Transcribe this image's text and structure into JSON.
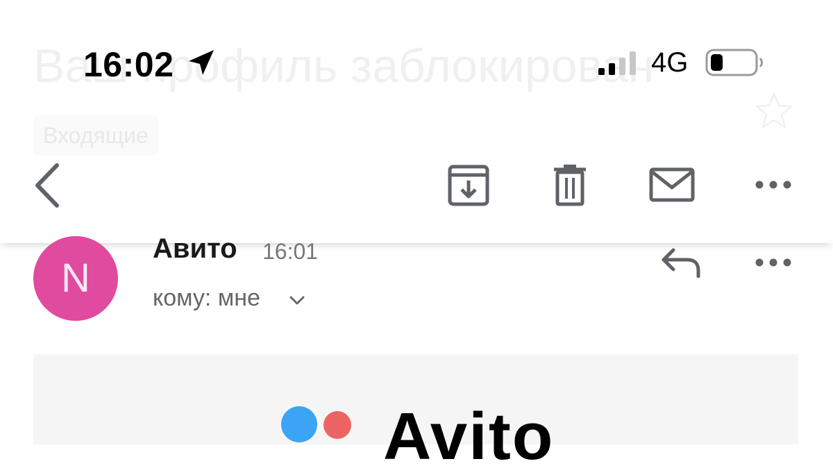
{
  "status_bar": {
    "time": "16:02",
    "network": "4G",
    "icons": [
      "location-arrow-icon",
      "signal-icon",
      "battery-icon"
    ]
  },
  "email": {
    "subject": "Ваш профиль заблокирован",
    "folder": "Входящие",
    "sender": "Авито",
    "sender_initial": "N",
    "sent_time": "16:01",
    "recipient": "кому: мне",
    "brand_logo_text": "Avito"
  },
  "toolbar": {
    "icons": [
      "back-icon",
      "archive-icon",
      "trash-icon",
      "mail-icon",
      "more-icon"
    ]
  },
  "colors": {
    "avatar_bg": "#e04a9f",
    "logo_blue": "#3ba4f5",
    "logo_red": "#ec6464",
    "icon_gray": "#5f6368"
  }
}
